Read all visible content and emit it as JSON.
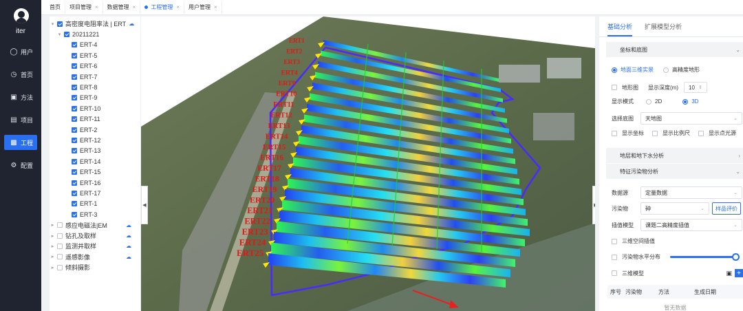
{
  "sidebar": {
    "user": "iter",
    "items": [
      {
        "label": "用户",
        "icon": "user-icon"
      },
      {
        "label": "首页",
        "icon": "clock-icon"
      },
      {
        "label": "方法",
        "icon": "briefcase-icon"
      },
      {
        "label": "项目",
        "icon": "document-icon"
      },
      {
        "label": "工程",
        "icon": "bar-chart-icon",
        "active": true
      },
      {
        "label": "配置",
        "icon": "gear-icon"
      }
    ]
  },
  "tabs": [
    {
      "label": "首页",
      "closable": false
    },
    {
      "label": "项目管理",
      "closable": true
    },
    {
      "label": "数据管理",
      "closable": true
    },
    {
      "label": "工程管理",
      "closable": true,
      "active": true
    },
    {
      "label": "用户管理",
      "closable": true
    }
  ],
  "tree": {
    "root_label": "高密度电阻率法 | ERT",
    "date_label": "20211221",
    "ert_items": [
      "ERT-4",
      "ERT-5",
      "ERT-6",
      "ERT-7",
      "ERT-8",
      "ERT-9",
      "ERT-10",
      "ERT-11",
      "ERT-2",
      "ERT-12",
      "ERT-13",
      "ERT-14",
      "ERT-15",
      "ERT-16",
      "ERT-17",
      "ERT-1",
      "ERT-3"
    ],
    "other_items": [
      {
        "label": "感应电磁法|EM",
        "cloud": true
      },
      {
        "label": "钻孔及取样",
        "cloud": true
      },
      {
        "label": "监测井取样",
        "cloud": true
      },
      {
        "label": "遥感影像",
        "cloud": true
      },
      {
        "label": "倾斜摄影",
        "cloud": false
      }
    ]
  },
  "map": {
    "profile_labels": [
      "ERT1",
      "ERT2",
      "ERT3",
      "ERT4",
      "ERT9",
      "ERT10",
      "ERT11",
      "ERT12",
      "ERT13",
      "ERT14",
      "ERT15",
      "ERT16",
      "ERT17",
      "ERT18",
      "ERT19",
      "ERT20",
      "ERT21",
      "ERT22",
      "ERT23",
      "ERT24",
      "ERT25"
    ]
  },
  "right_panel": {
    "tabs": [
      "基础分析",
      "扩展模型分析"
    ],
    "section1": "坐标和底图",
    "radio_terrain": [
      "地面三维实景",
      "高精度地形"
    ],
    "terrain_map_label": "地形图",
    "depth_label": "显示深度(m)",
    "depth_value": "10",
    "mode_label": "显示模式",
    "mode_options": [
      "2D",
      "3D"
    ],
    "basemap_label": "选择底图",
    "basemap_value": "天地图",
    "show_options": [
      "显示坐标",
      "显示比例尺",
      "显示点光源"
    ],
    "section2": "地层和地下水分析",
    "section3": "特征污染物分析",
    "datasource_label": "数据源",
    "datasource_value": "定量数据",
    "pollutant_label": "污染物",
    "pollutant_value": "砷",
    "evaluate_button": "样品评价",
    "interp_label": "插值模型",
    "interp_value": "课题二高精度插值",
    "spatial_interp": "三维空间插值",
    "horizontal_dist": "污染物水平分布",
    "model3d": "三维模型",
    "table_headers": [
      "序号",
      "污染物",
      "方法",
      "生成日期"
    ],
    "no_data": "暂无数据",
    "slider_value": 1.0
  }
}
